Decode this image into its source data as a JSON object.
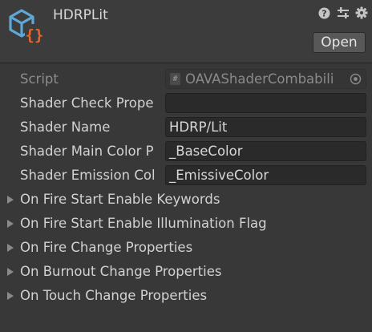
{
  "header": {
    "title": "HDRPLit",
    "open_label": "Open",
    "icons": [
      "help-icon",
      "preset-sliders-icon",
      "settings-gear-icon"
    ]
  },
  "fields": [
    {
      "label": "Script",
      "value": "OAVAShaderCombabili",
      "disabled": true
    },
    {
      "label": "Shader Check Prope",
      "value": ""
    },
    {
      "label": "Shader Name",
      "value": "HDRP/Lit"
    },
    {
      "label": "Shader Main Color P",
      "value": "_BaseColor"
    },
    {
      "label": "Shader Emission Col",
      "value": "_EmissiveColor"
    }
  ],
  "foldouts": [
    {
      "label": "On Fire Start Enable Keywords"
    },
    {
      "label": "On Fire Start Enable Illumination Flag"
    },
    {
      "label": "On Fire Change Properties"
    },
    {
      "label": "On Burnout Change Properties"
    },
    {
      "label": "On Touch Change Properties"
    }
  ],
  "colors": {
    "background": "#383838",
    "header": "#3c3c3c",
    "field": "#2a2a2a",
    "logo_blue": "#5fa8d6",
    "logo_orange": "#e8642a"
  }
}
